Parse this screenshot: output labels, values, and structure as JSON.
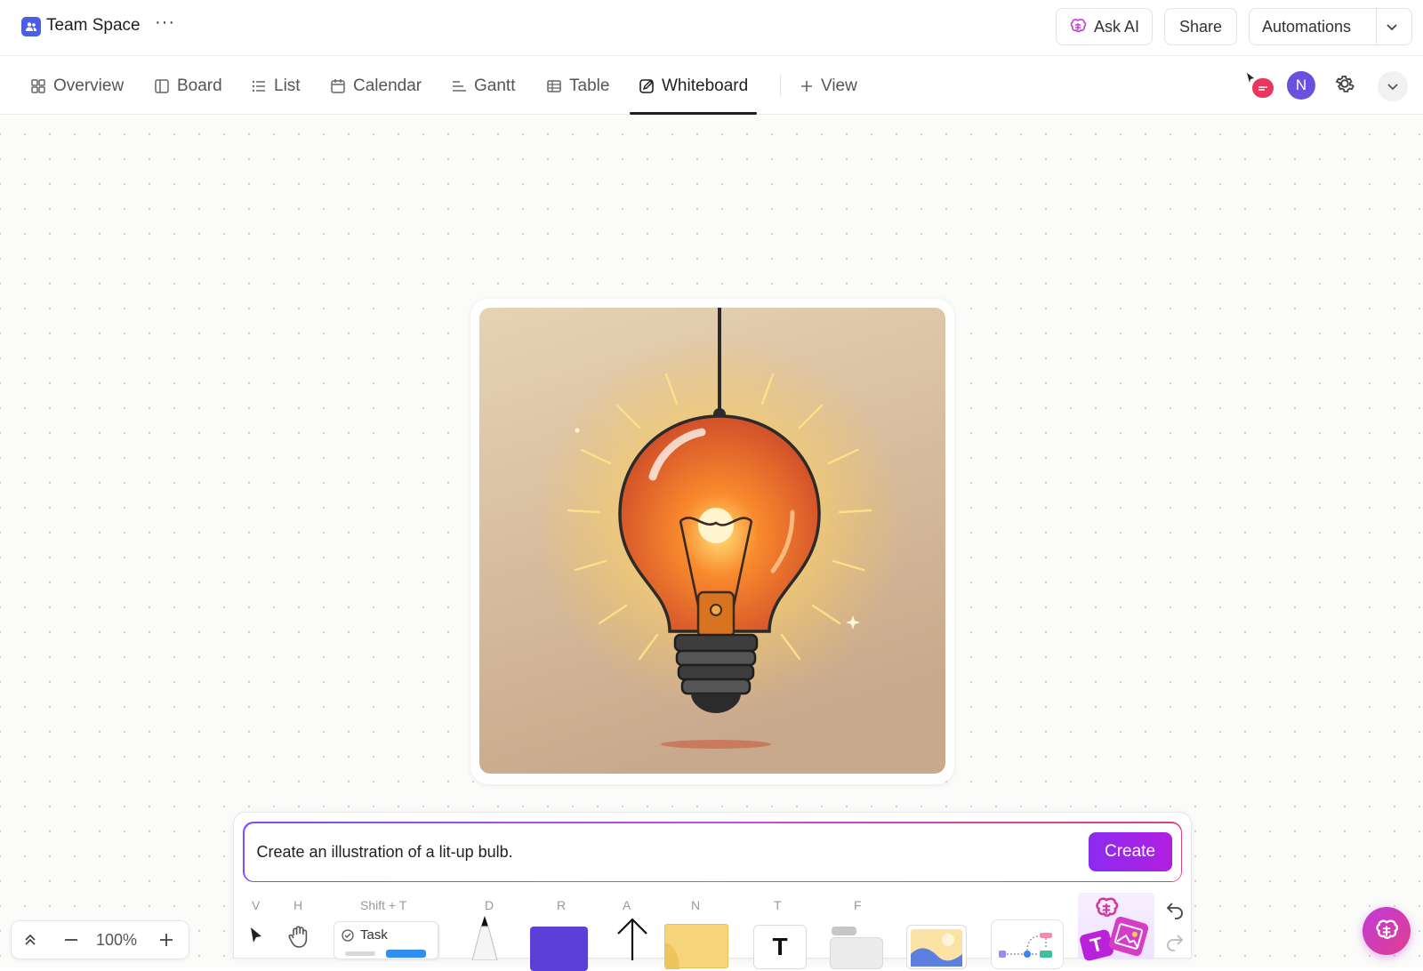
{
  "header": {
    "space_title": "Team Space",
    "more_label": "···",
    "ask_ai_label": "Ask AI",
    "share_label": "Share",
    "automations_label": "Automations"
  },
  "tabs": [
    {
      "label": "Overview",
      "icon": "overview-icon"
    },
    {
      "label": "Board",
      "icon": "board-icon"
    },
    {
      "label": "List",
      "icon": "list-icon"
    },
    {
      "label": "Calendar",
      "icon": "calendar-icon"
    },
    {
      "label": "Gantt",
      "icon": "gantt-icon"
    },
    {
      "label": "Table",
      "icon": "table-icon"
    },
    {
      "label": "Whiteboard",
      "icon": "whiteboard-icon",
      "active": true
    }
  ],
  "add_view_label": "View",
  "user": {
    "avatar_initial": "N",
    "avatar_color": "#6b4fe0"
  },
  "prompt": {
    "text": "Create an illustration of a lit-up bulb.",
    "create_label": "Create"
  },
  "toolbar": {
    "shortcuts": {
      "select": "V",
      "hand": "H",
      "task": "Shift + T",
      "draw": "D",
      "rectangle": "R",
      "arrow": "A",
      "note": "N",
      "text": "T",
      "frame": "F"
    },
    "task_label": "Task",
    "text_tool_glyph": "T",
    "ai_card_glyph": "T"
  },
  "zoom": {
    "level": "100%"
  },
  "colors": {
    "accent_purple": "#8b2bf0",
    "shape_fill": "#5b3fd6",
    "sticky_note": "#f6d57a",
    "avatar": "#6b4fe0",
    "badge": "#e8365d"
  }
}
